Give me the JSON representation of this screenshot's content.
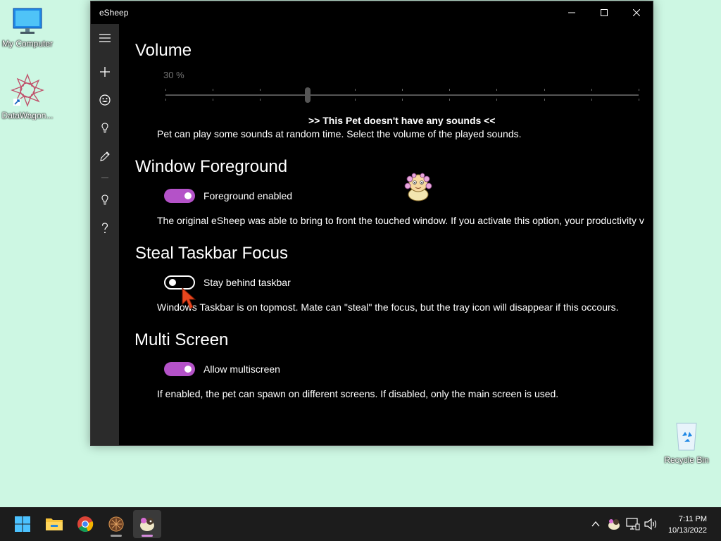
{
  "desktop": {
    "icons": [
      {
        "label": "My Computer",
        "icon": "computer-icon"
      },
      {
        "label": "DataWagon...",
        "icon": "datawagon-icon"
      },
      {
        "label": "Recycle Bin",
        "icon": "recycle-bin-icon"
      }
    ]
  },
  "window": {
    "title": "eSheep",
    "controls": [
      "minimize-icon",
      "maximize-icon",
      "close-icon"
    ]
  },
  "sidebar": {
    "items": [
      "menu-icon",
      "add-icon",
      "emoji-icon",
      "lightbulb-icon",
      "pencil-icon",
      "lightbulb-icon",
      "help-icon"
    ]
  },
  "sections": {
    "volume": {
      "heading": "Volume",
      "value_text": "30 %",
      "value": 30,
      "notice": ">> This Pet doesn't have any sounds <<",
      "description": "Pet can play some sounds at random time. Select the volume of the played sounds."
    },
    "foreground": {
      "heading": "Window Foreground",
      "toggle_label": "Foreground enabled",
      "toggle_on": true,
      "description": "The original eSheep was able to bring to front the touched window. If you activate this option, your productivity v"
    },
    "taskbar_focus": {
      "heading": "Steal Taskbar Focus",
      "toggle_label": "Stay behind taskbar",
      "toggle_on": false,
      "description": "Windows Taskbar is on topmost. Mate can \"steal\" the focus, but the tray icon will disappear if this occours."
    },
    "multiscreen": {
      "heading": "Multi Screen",
      "toggle_label": "Allow multiscreen",
      "toggle_on": true,
      "description": "If enabled, the pet can spawn on different screens. If disabled, only the main screen is used."
    }
  },
  "taskbar": {
    "apps": [
      "windows-start-icon",
      "file-explorer-icon",
      "chrome-icon",
      "datawagon-app-icon",
      "esheep-app-icon"
    ],
    "tray": [
      "chevron-up-icon",
      "esheep-tray-icon",
      "network-icon",
      "volume-icon"
    ],
    "time": "7:11 PM",
    "date": "10/13/2022"
  },
  "colors": {
    "desktop": "#cdf7e3",
    "accent": "#b452c8",
    "window_bg": "#000000",
    "sidebar_bg": "#2b2b2b",
    "taskbar_bg": "#1c1c1c"
  }
}
